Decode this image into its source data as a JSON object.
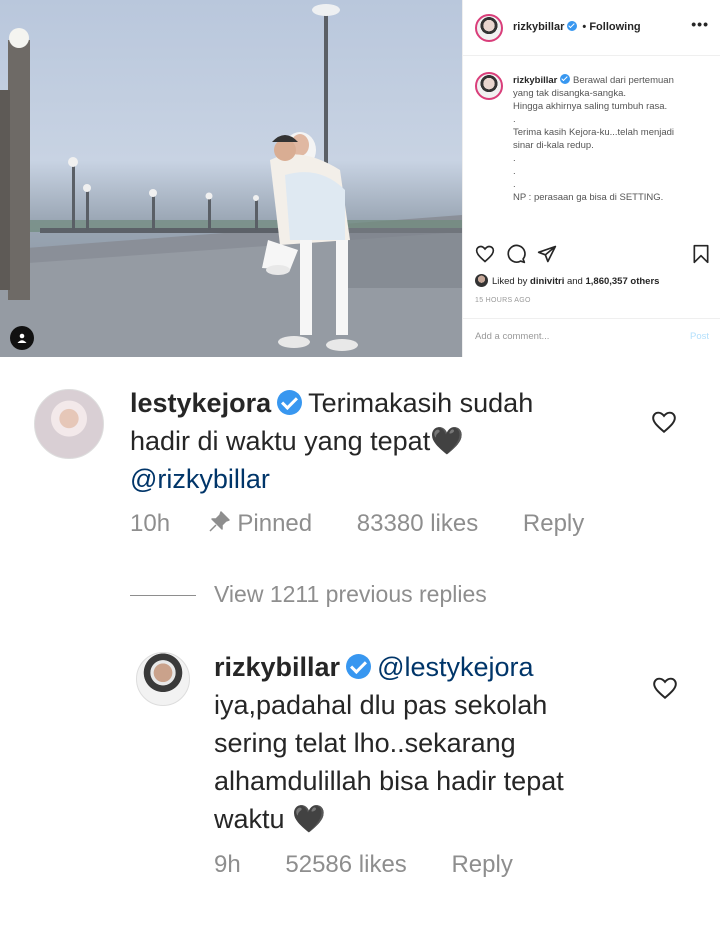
{
  "post": {
    "username": "rizkybillar",
    "follow_status": "• Following",
    "more_label": "•••",
    "caption_lines": [
      "Berawal dari pertemuan",
      "yang tak disangka-sangka.",
      "Hingga akhirnya saling tumbuh rasa.",
      ".",
      "Terima kasih Kejora-ku...telah menjadi",
      "sinar di-kala redup.",
      ".",
      ".",
      ".",
      "NP : perasaan ga bisa di SETTING."
    ],
    "liked_by_prefix": "Liked by ",
    "liked_by_user": "dinivitri",
    "liked_by_and": " and ",
    "liked_by_others": "1,860,357 others",
    "time_ago": "15 HOURS AGO",
    "comment_placeholder": "Add a comment...",
    "post_button": "Post"
  },
  "comments": [
    {
      "username": "lestykejora",
      "text_line1": "Terimakasih sudah",
      "text_line2": "hadir di waktu yang tepat",
      "heart_glyph": "🖤",
      "mention": "@rizkybillar",
      "time": "10h",
      "pinned": "Pinned",
      "likes": "83380 likes",
      "reply": "Reply"
    },
    {
      "username": "rizkybillar",
      "mention": "@lestykejora",
      "text_line1": "iya,padahal dlu pas sekolah",
      "text_line2": "sering telat lho..sekarang",
      "text_line3": "alhamdulillah bisa hadir tepat",
      "text_line4": "waktu",
      "heart_glyph": "🖤",
      "time": "9h",
      "likes": "52586 likes",
      "reply": "Reply"
    }
  ],
  "view_replies": "View 1211 previous replies",
  "colors": {
    "verified": "#3897f0",
    "mention": "#003569",
    "muted": "#8e8e8e",
    "text": "#262626"
  },
  "icons": [
    "heart-icon",
    "comment-icon",
    "share-icon",
    "bookmark-icon",
    "pin-icon",
    "verified-icon",
    "user-tag-icon"
  ]
}
